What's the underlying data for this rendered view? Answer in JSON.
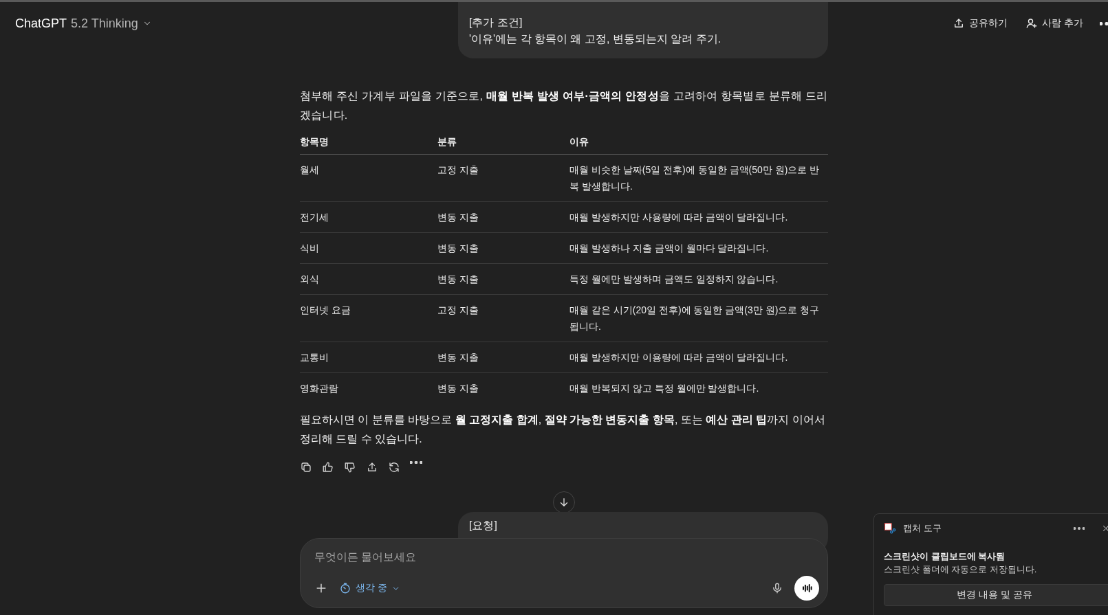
{
  "header": {
    "brand": "ChatGPT",
    "model": "5.2 Thinking",
    "actions": [
      {
        "kind": "share",
        "label": "공유하기"
      },
      {
        "kind": "add-person",
        "label": "사람 추가"
      }
    ]
  },
  "top_bubble": {
    "lines": [
      "[추가 조건]",
      "'이유'에는 각 항목이 왜 고정, 변동되는지 알려 주기."
    ]
  },
  "answer": {
    "intro": "첨부해 주신 가계부 파일을 기준으로, **매월 반복 발생 여부·금액의 안정성**을 고려하여 항목별로 분류해 드리겠습니다.",
    "table": {
      "columns": [
        "항목명",
        "분류",
        "이유"
      ],
      "rows": [
        [
          "월세",
          "고정 지출",
          "매월 비슷한 날짜(5일 전후)에 동일한 금액(50만 원)으로 반복 발생합니다."
        ],
        [
          "전기세",
          "변동 지출",
          "매월 발생하지만 사용량에 따라 금액이 달라집니다."
        ],
        [
          "식비",
          "변동 지출",
          "매월 발생하나 지출 금액이 월마다 달라집니다."
        ],
        [
          "외식",
          "변동 지출",
          "특정 월에만 발생하며 금액도 일정하지 않습니다."
        ],
        [
          "인터넷 요금",
          "고정 지출",
          "매월 같은 시기(20일 전후)에 동일한 금액(3만 원)으로 청구됩니다."
        ],
        [
          "교통비",
          "변동 지출",
          "매월 발생하지만 이용량에 따라 금액이 달라집니다."
        ],
        [
          "영화관람",
          "변동 지출",
          "매월 반복되지 않고 특정 월에만 발생합니다."
        ]
      ]
    },
    "outro": "필요하시면 이 분류를 바탕으로 **월 고정지출 합계**, **절약 가능한 변동지출 항목**, 또는 **예산 관리 팁**까지 이어서 정리해 드릴 수 있습니다."
  },
  "bottom_bubble": {
    "lines": [
      "[요청]"
    ]
  },
  "composer": {
    "placeholder": "무엇이든 물어보세요",
    "mode": "생각 중"
  },
  "toast": {
    "app": "캡처 도구",
    "title": "스크린샷이 클립보드에 복사됨",
    "body": "스크린샷 폴더에 자동으로 저장됩니다.",
    "button": "변경 내용 및 공유"
  }
}
